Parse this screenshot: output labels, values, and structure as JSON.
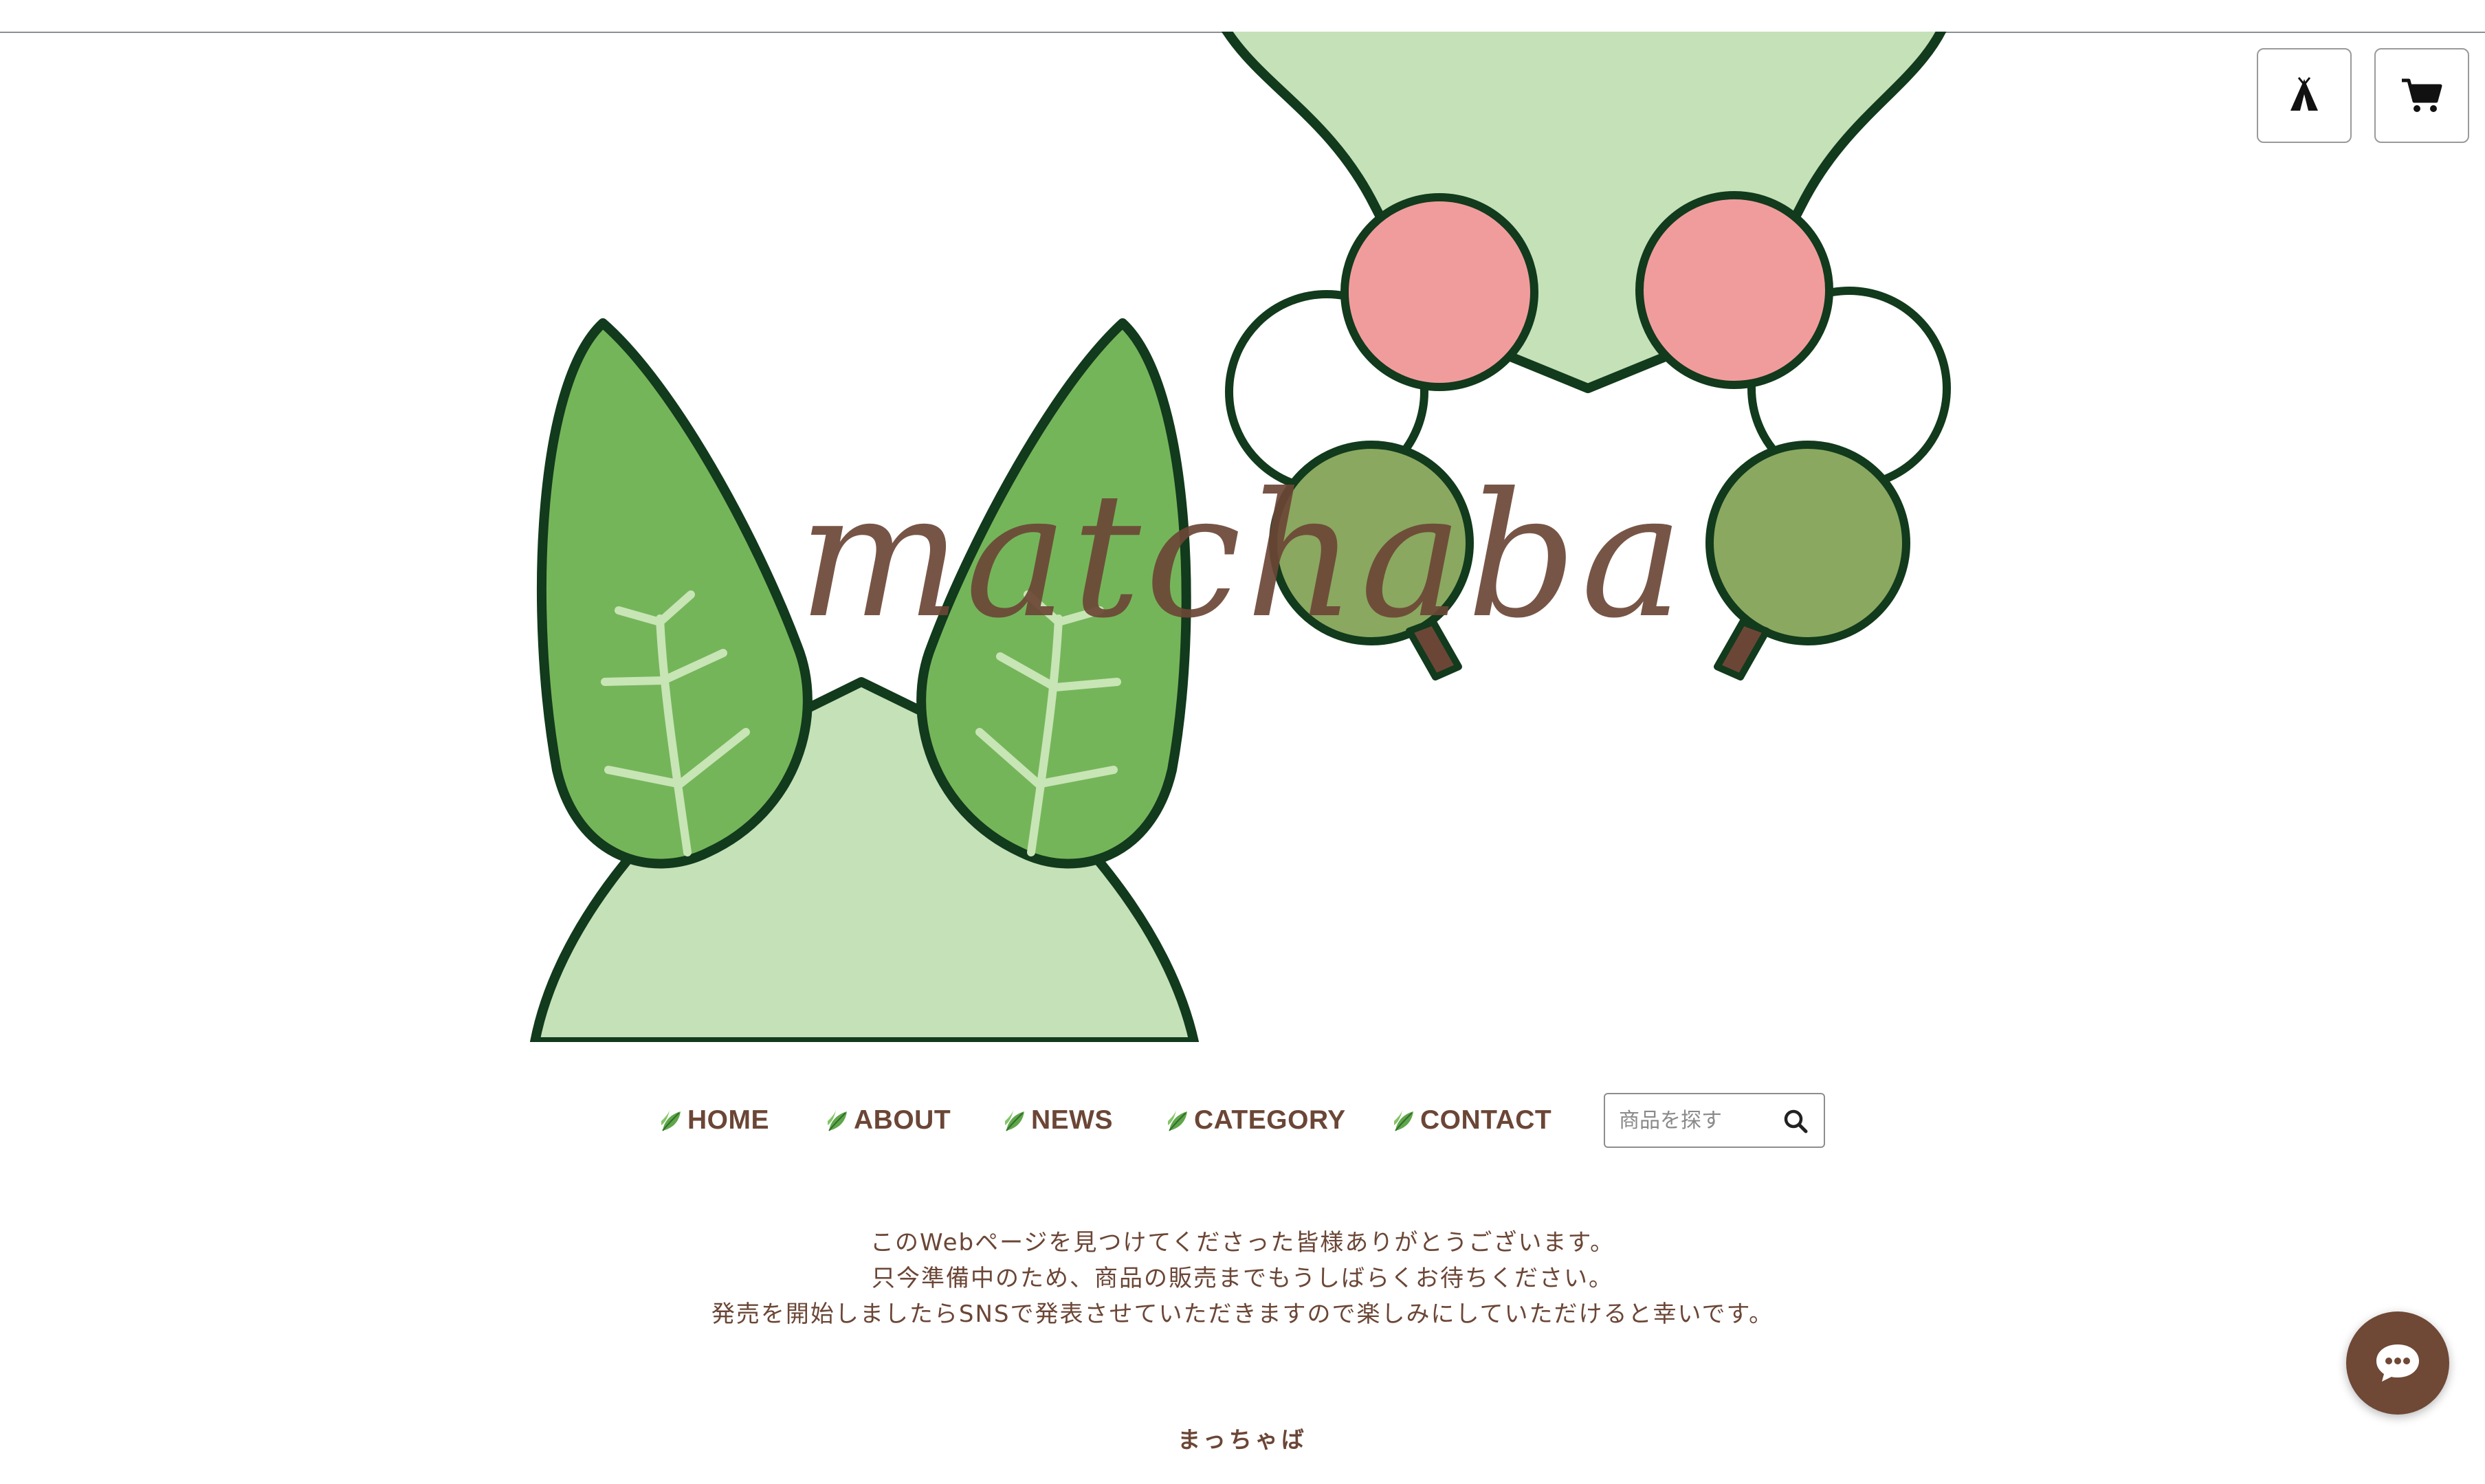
{
  "header": {
    "icons": [
      {
        "name": "tent-icon",
        "label": "store home"
      },
      {
        "name": "cart-icon",
        "label": "cart"
      }
    ]
  },
  "hero": {
    "logo_text": "matchaba"
  },
  "nav": {
    "items": [
      {
        "label": "HOME",
        "icon": "leaf-icon"
      },
      {
        "label": "ABOUT",
        "icon": "leaf-icon"
      },
      {
        "label": "NEWS",
        "icon": "leaf-icon"
      },
      {
        "label": "CATEGORY",
        "icon": "leaf-icon"
      },
      {
        "label": "CONTACT",
        "icon": "leaf-icon"
      }
    ]
  },
  "search": {
    "placeholder": "商品を探す",
    "value": "",
    "icon": "search-icon"
  },
  "message": {
    "lines": [
      "このWebページを見つけてくださった皆様ありがとうございます。",
      "只今準備中のため、商品の販売までもうしばらくお待ちください。",
      "発売を開始しましたらSNSで発表させていただきますので楽しみにしていただけると幸いです。"
    ]
  },
  "footer": {
    "shop_name": "まっちゃば"
  },
  "chat": {
    "icon": "chat-bubble-icon"
  },
  "colors": {
    "brand_brown": "#6b4636",
    "leaf_green": "#75b55a",
    "light_green": "#c4e1b8",
    "dark_outline": "#123a1c",
    "dango_pink": "#f19c9c",
    "dango_green": "#8aa860"
  }
}
